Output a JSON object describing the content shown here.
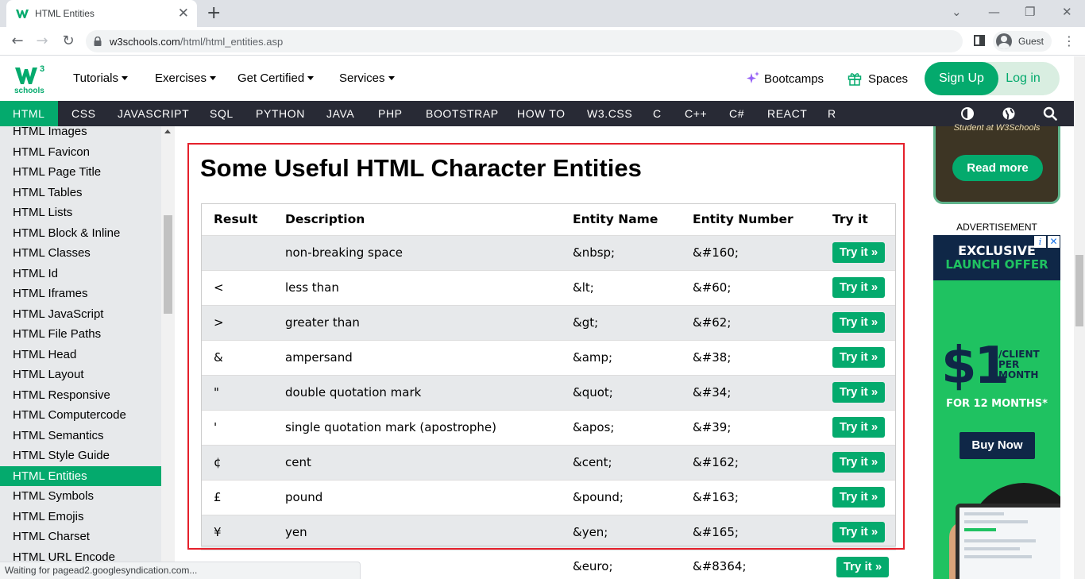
{
  "browser": {
    "tab_title": "HTML Entities",
    "url_host": "w3schools.com",
    "url_path": "/html/html_entities.asp",
    "profile_name": "Guest",
    "status_text": "Waiting for pagead2.googlesyndication.com..."
  },
  "header": {
    "logo_text": "schools",
    "logo_mark": "W",
    "logo_sup": "3",
    "nav": [
      "Tutorials",
      "Exercises",
      "Get Certified",
      "Services"
    ],
    "bootcamps": "Bootcamps",
    "spaces": "Spaces",
    "signup": "Sign Up",
    "login": "Log in",
    "accent": "#04aa6d"
  },
  "topics": [
    "HTML",
    "CSS",
    "JAVASCRIPT",
    "SQL",
    "PYTHON",
    "JAVA",
    "PHP",
    "BOOTSTRAP",
    "HOW TO",
    "W3.CSS",
    "C",
    "C++",
    "C#",
    "REACT",
    "R"
  ],
  "sidebar": {
    "items": [
      "HTML Images",
      "HTML Favicon",
      "HTML Page Title",
      "HTML Tables",
      "HTML Lists",
      "HTML Block & Inline",
      "HTML Classes",
      "HTML Id",
      "HTML Iframes",
      "HTML JavaScript",
      "HTML File Paths",
      "HTML Head",
      "HTML Layout",
      "HTML Responsive",
      "HTML Computercode",
      "HTML Semantics",
      "HTML Style Guide",
      "HTML Entities",
      "HTML Symbols",
      "HTML Emojis",
      "HTML Charset",
      "HTML URL Encode"
    ],
    "active": "HTML Entities"
  },
  "main": {
    "heading": "Some Useful HTML Character Entities",
    "columns": [
      "Result",
      "Description",
      "Entity Name",
      "Entity Number",
      "Try it"
    ],
    "try_label": "Try it »",
    "rows": [
      {
        "result": "",
        "description": "non-breaking space",
        "name": "&nbsp;",
        "number": "&#160;"
      },
      {
        "result": "<",
        "description": "less than",
        "name": "&lt;",
        "number": "&#60;"
      },
      {
        "result": ">",
        "description": "greater than",
        "name": "&gt;",
        "number": "&#62;"
      },
      {
        "result": "&",
        "description": "ampersand",
        "name": "&amp;",
        "number": "&#38;"
      },
      {
        "result": "\"",
        "description": "double quotation mark",
        "name": "&quot;",
        "number": "&#34;"
      },
      {
        "result": "'",
        "description": "single quotation mark (apostrophe)",
        "name": "&apos;",
        "number": "&#39;"
      },
      {
        "result": "¢",
        "description": "cent",
        "name": "&cent;",
        "number": "&#162;"
      },
      {
        "result": "£",
        "description": "pound",
        "name": "&pound;",
        "number": "&#163;"
      },
      {
        "result": "¥",
        "description": "yen",
        "name": "&yen;",
        "number": "&#165;"
      }
    ],
    "partial_row": {
      "name": "&euro;",
      "number": "&#8364;"
    }
  },
  "right": {
    "promo_sub": "Student at W3Schools",
    "read_more": "Read more",
    "ad_label": "ADVERTISEMENT",
    "ad_line1": "EXCLUSIVE",
    "ad_line2": "LAUNCH OFFER",
    "ad_price": "$1",
    "ad_per": "/CLIENT PER MONTH",
    "ad_months": "FOR 12 MONTHS*",
    "ad_buy": "Buy Now"
  }
}
